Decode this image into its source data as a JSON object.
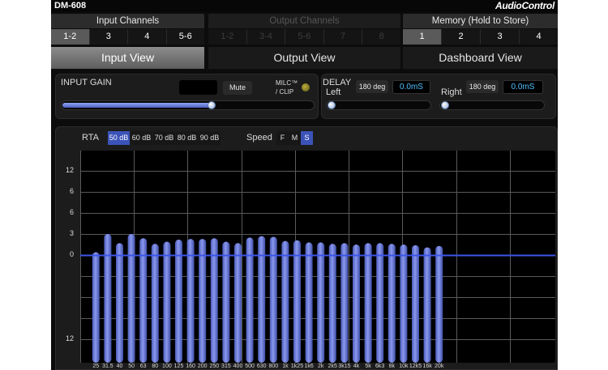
{
  "app": {
    "model": "DM-608",
    "brand": "AudioControl"
  },
  "input_channels": {
    "title": "Input Channels",
    "items": [
      "1-2",
      "3",
      "4",
      "5-6"
    ],
    "selected": 0
  },
  "output_channels": {
    "title": "Output Channels",
    "items": [
      "1-2",
      "3-4",
      "5-6",
      "7",
      "8"
    ]
  },
  "memory": {
    "title": "Memory (Hold to Store)",
    "items": [
      "1",
      "2",
      "3",
      "4"
    ],
    "selected": 0
  },
  "tabs": [
    "Input View",
    "Output View",
    "Dashboard View"
  ],
  "selected_tab": 0,
  "input_gain": {
    "label": "INPUT GAIN",
    "mute_label": "Mute",
    "milc_label": "MILC™",
    "clip_label": "/ CLIP",
    "level": 0.6
  },
  "delay": {
    "label": "DELAY",
    "left": {
      "label": "Left",
      "phase": "180 deg",
      "value": "0.0mS",
      "level": 0.0
    },
    "right": {
      "label": "Right",
      "phase": "180 deg",
      "value": "0.0mS",
      "level": 0.0
    }
  },
  "rta": {
    "label": "RTA",
    "ranges": [
      "50 dB",
      "60 dB",
      "70 dB",
      "80 dB",
      "90 dB"
    ],
    "selected_range": 0,
    "speed_label": "Speed",
    "speeds": [
      "F",
      "M",
      "S"
    ],
    "selected_speed": 2
  },
  "colors": {
    "accent": "#3b53b8",
    "bar": "#6f7fe0",
    "value_text": "#4fc1ff",
    "zero_line": "#3d55e8"
  },
  "chart_data": {
    "type": "bar",
    "x_tick_labels": [
      "25",
      "31.5",
      "40",
      "50",
      "63",
      "80",
      "100",
      "125",
      "160",
      "200",
      "250",
      "315",
      "400",
      "500",
      "630",
      "800",
      "1k",
      "1k25",
      "1k6",
      "2k",
      "2k5",
      "3k15",
      "4k",
      "5k",
      "6k3",
      "8k",
      "10k",
      "12k5",
      "16k",
      "20k"
    ],
    "y_tick_labels": [
      "12",
      "6",
      "0",
      "3",
      "6",
      "12"
    ],
    "ylim": [
      -12,
      12
    ],
    "grid": true,
    "series": [
      {
        "values": [
          0.4,
          3.0,
          1.7,
          3.0,
          2.4,
          1.6,
          1.9,
          2.2,
          2.3,
          2.3,
          2.4,
          1.9,
          1.7,
          2.5,
          2.7,
          2.6,
          2.0,
          2.1,
          1.8,
          1.8,
          1.6,
          1.7,
          1.5,
          1.7,
          1.7,
          1.6,
          1.5,
          1.4,
          1.1,
          1.3
        ]
      }
    ]
  }
}
